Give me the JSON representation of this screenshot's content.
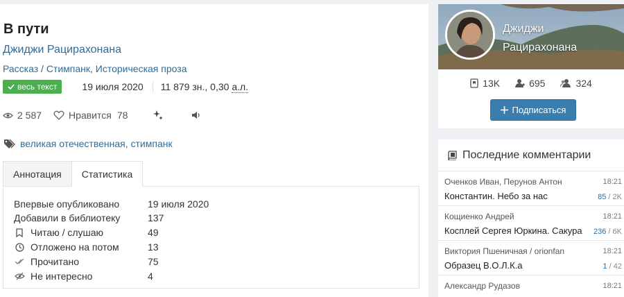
{
  "work": {
    "title": "В пути",
    "author": "Джиджи Рацирахонана",
    "genres": [
      "Рассказ",
      "Стимпанк",
      "Историческая проза"
    ],
    "badge": "весь текст",
    "date": "19 июля 2020",
    "size_chars": "11 879 зн., 0,30",
    "size_unit": "а.л.",
    "views": "2 587",
    "likes_label": "Нравится",
    "likes": "78",
    "tags": "великая отечественная, стимпанк"
  },
  "tabs": [
    {
      "label": "Аннотация",
      "active": false
    },
    {
      "label": "Статистика",
      "active": true
    }
  ],
  "stats": [
    {
      "label": "Впервые опубликовано",
      "value": "19 июля 2020",
      "icon": ""
    },
    {
      "label": "Добавили в библиотеку",
      "value": "137",
      "icon": ""
    },
    {
      "label": "Читаю / слушаю",
      "value": "49",
      "icon": "bookmark-icon"
    },
    {
      "label": "Отложено на потом",
      "value": "13",
      "icon": "clock-icon"
    },
    {
      "label": "Прочитано",
      "value": "75",
      "icon": "double-check-icon"
    },
    {
      "label": "Не интересно",
      "value": "4",
      "icon": "eye-slash-icon"
    }
  ],
  "profile": {
    "name_line1": "Джиджи",
    "name_line2": "Рацирахонана",
    "counters": [
      {
        "icon": "book-icon",
        "value": "13K"
      },
      {
        "icon": "user-icon",
        "value": "695"
      },
      {
        "icon": "users-icon",
        "value": "324"
      }
    ],
    "subscribe_label": "Подписаться"
  },
  "comments": {
    "title": "Последние комментарии",
    "items": [
      {
        "who": "Оченков Иван, Перунов Антон",
        "time": "18:21",
        "book": "Константин. Небо за нас",
        "count": "85",
        "total": "2K"
      },
      {
        "who": "Кощиенко Андрей",
        "time": "18:21",
        "book": "Косплей Сергея Юркина. Сакура",
        "count": "236",
        "total": "6K"
      },
      {
        "who": "Виктория Пшеничная / orionfan",
        "time": "18:21",
        "book": "Образец В.О.Л.К.а",
        "count": "1",
        "total": "42"
      },
      {
        "who": "Александр Рудазов",
        "time": "18:21",
        "book": "",
        "count": "",
        "total": ""
      }
    ]
  },
  "colors": {
    "accent": "#2d6d9c",
    "badge": "#4bae4f",
    "button": "#3a7eb0"
  }
}
